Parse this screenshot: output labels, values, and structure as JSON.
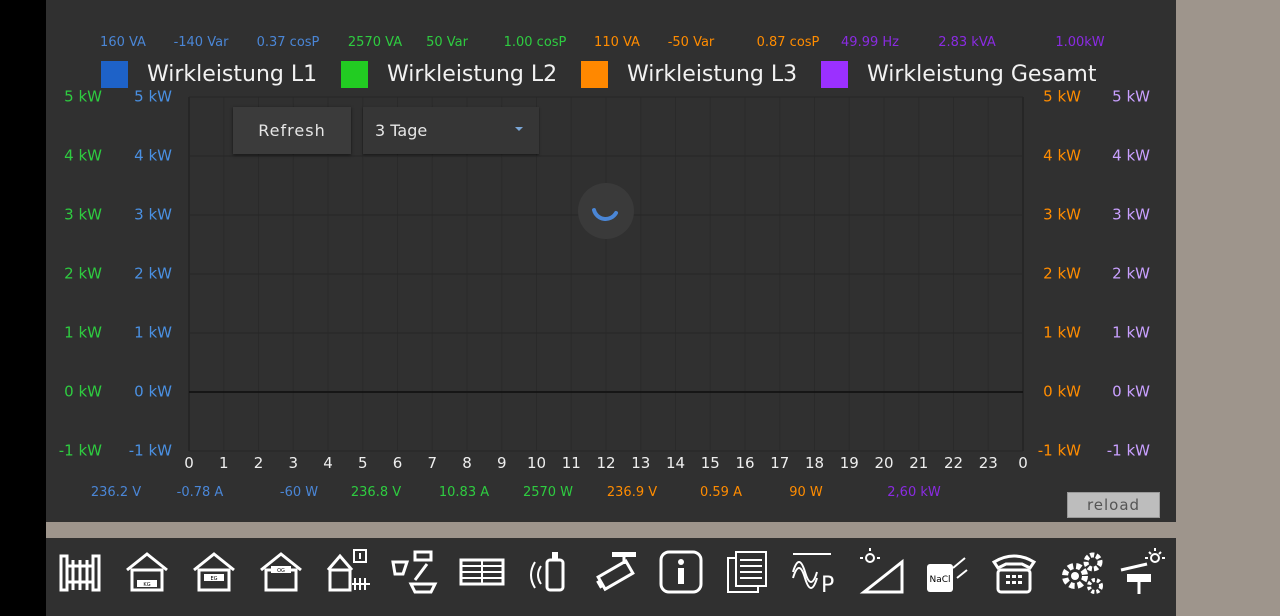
{
  "stats_top": [
    {
      "text": "160 VA",
      "color": "#4a86d6"
    },
    {
      "text": "-140 Var",
      "color": "#4a86d6"
    },
    {
      "text": "0.37 cosP",
      "color": "#4a86d6"
    },
    {
      "text": "2570 VA",
      "color": "#2ecc40"
    },
    {
      "text": "50 Var",
      "color": "#2ecc40"
    },
    {
      "text": "1.00 cosP",
      "color": "#2ecc40"
    },
    {
      "text": "110 VA",
      "color": "#ff8c00"
    },
    {
      "text": "-50 Var",
      "color": "#ff8c00"
    },
    {
      "text": "0.87 cosP",
      "color": "#ff8c00"
    },
    {
      "text": "49.99 Hz",
      "color": "#8a2be2"
    },
    {
      "text": "2.83 kVA",
      "color": "#8a2be2"
    },
    {
      "text": "1.00kW",
      "color": "#8a2be2"
    }
  ],
  "stats_bottom": [
    {
      "text": "236.2 V",
      "color": "#4a86d6"
    },
    {
      "text": "-0.78 A",
      "color": "#4a86d6"
    },
    {
      "text": "-60 W",
      "color": "#4a86d6"
    },
    {
      "text": "236.8 V",
      "color": "#2ecc40"
    },
    {
      "text": "10.83 A",
      "color": "#2ecc40"
    },
    {
      "text": "2570 W",
      "color": "#2ecc40"
    },
    {
      "text": "236.9 V",
      "color": "#ff8c00"
    },
    {
      "text": "0.59 A",
      "color": "#ff8c00"
    },
    {
      "text": "90 W",
      "color": "#ff8c00"
    },
    {
      "text": "2,60 kW",
      "color": "#8a2be2"
    }
  ],
  "controls": {
    "refresh_label": "Refresh",
    "range_value": "3 Tage",
    "reload_label": "reload"
  },
  "chart_data": {
    "type": "line",
    "series": [
      {
        "name": "Wirkleistung L1",
        "color": "#1e62c8",
        "axis_color": "#4a90e2",
        "values": []
      },
      {
        "name": "Wirkleistung L2",
        "color": "#22cc22",
        "axis_color": "#2ecc40",
        "values": []
      },
      {
        "name": "Wirkleistung L3",
        "color": "#ff8800",
        "axis_color": "#ff8c00",
        "values": []
      },
      {
        "name": "Wirkleistung Gesamt",
        "color": "#9b30ff",
        "axis_color": "#c9a0ff",
        "values": []
      }
    ],
    "y_ticks": [
      "5 kW",
      "4 kW",
      "3 kW",
      "2 kW",
      "1 kW",
      "0 kW",
      "-1 kW"
    ],
    "ylim": [
      -1,
      5
    ],
    "x_ticks": [
      "0",
      "1",
      "2",
      "3",
      "4",
      "5",
      "6",
      "7",
      "8",
      "9",
      "10",
      "11",
      "12",
      "13",
      "14",
      "15",
      "16",
      "17",
      "18",
      "19",
      "20",
      "21",
      "22",
      "23",
      "0"
    ],
    "grid": true,
    "loading": true
  },
  "nav_icons": [
    "fence-gate-icon",
    "house-kg-icon",
    "house-eg-icon",
    "house-og-icon",
    "house-info-icon",
    "bathroom-icon",
    "blinds-icon",
    "wireless-sensor-icon",
    "camera-icon",
    "info-icon",
    "documents-icon",
    "power-meter-icon",
    "solar-panel-icon",
    "salt-tank-icon",
    "telephone-icon",
    "settings-gears-icon",
    "garden-light-icon"
  ]
}
